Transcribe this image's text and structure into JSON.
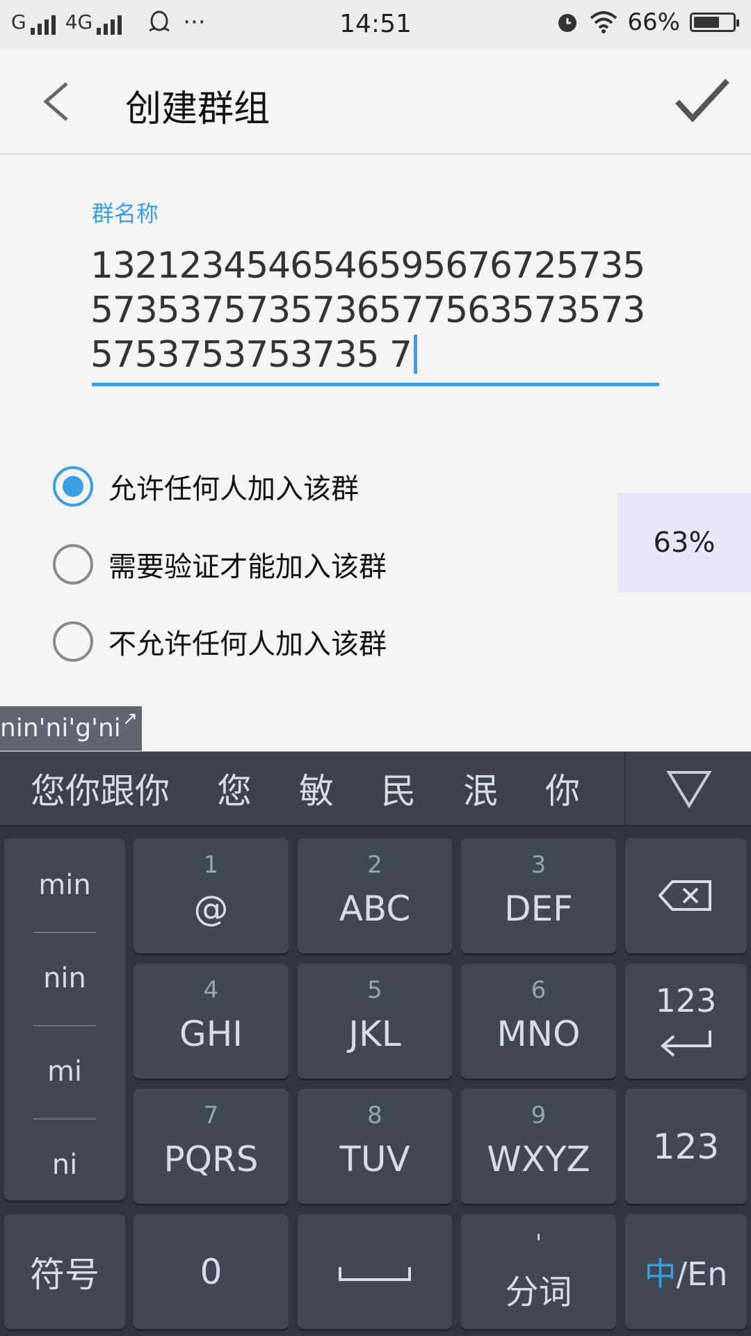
{
  "status_bar": {
    "network_left": "G",
    "network_4g": "4G",
    "more": "···",
    "time": "14:51",
    "battery": "66%",
    "battery_level": 0.66
  },
  "header": {
    "title": "创建群组",
    "back_icon": "chevron-left-icon",
    "confirm_icon": "checkmark-icon"
  },
  "form": {
    "group_name_label": "群名称",
    "group_name_value": "132123454654659567672573557353757357365775635735735753753753735 7",
    "options": [
      {
        "label": "允许任何人加入该群",
        "checked": true
      },
      {
        "label": "需要验证才能加入该群",
        "checked": false
      },
      {
        "label": "不允许任何人加入该群",
        "checked": false
      }
    ]
  },
  "overlay_badge": "63%",
  "ime": {
    "composing": "nin'ni'g'ni",
    "candidates": [
      "您你跟你",
      "您",
      "敏",
      "民",
      "泯",
      "你"
    ],
    "pinyin_options": [
      "min",
      "nin",
      "mi",
      "ni"
    ],
    "keys": [
      {
        "num": "1",
        "letters": "@"
      },
      {
        "num": "2",
        "letters": "ABC"
      },
      {
        "num": "3",
        "letters": "DEF"
      },
      {
        "num": "4",
        "letters": "GHI"
      },
      {
        "num": "5",
        "letters": "JKL"
      },
      {
        "num": "6",
        "letters": "MNO"
      },
      {
        "num": "7",
        "letters": "PQRS"
      },
      {
        "num": "8",
        "letters": "TUV"
      },
      {
        "num": "9",
        "letters": "WXYZ"
      }
    ],
    "enter_label": "123",
    "num_label": "123",
    "symbol_label": "符号",
    "zero_label": "0",
    "split_label": "分词",
    "split_mark": "'",
    "lang_zh": "中",
    "lang_en": "/En"
  },
  "colors": {
    "accent": "#3a9ee4",
    "keyboard_bg": "#2e3640",
    "key_bg": "#3f4853"
  }
}
